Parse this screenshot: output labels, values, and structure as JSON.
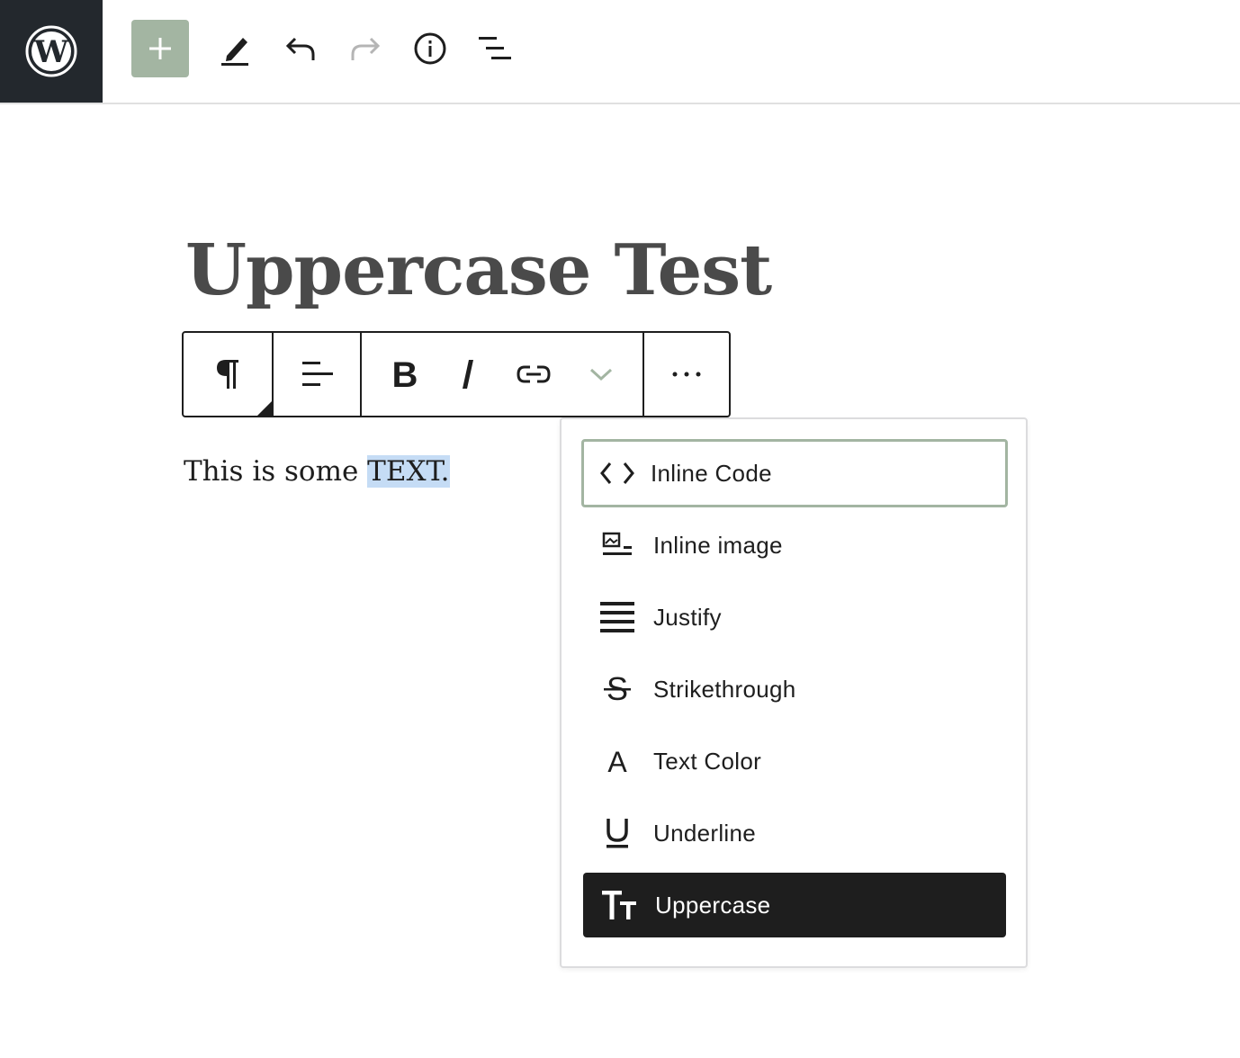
{
  "topbar": {
    "logo_icon": "wordpress-logo",
    "tools": [
      "add-block-icon",
      "edit-pencil-icon",
      "undo-icon",
      "redo-icon",
      "info-icon",
      "list-view-icon"
    ],
    "accent_color": "#a3b5a2"
  },
  "editor": {
    "post_title": "Uppercase Test",
    "paragraph_plain": "This is some ",
    "paragraph_selected": "TEXT."
  },
  "block_toolbar": {
    "buttons": [
      "paragraph-icon",
      "align-left-icon",
      "bold-icon",
      "italic-icon",
      "link-icon",
      "chevron-down-icon",
      "more-options-icon"
    ]
  },
  "format_menu": {
    "items": [
      {
        "label": "Inline Code",
        "icon": "code-brackets-icon",
        "state": "focused"
      },
      {
        "label": "Inline image",
        "icon": "inline-image-icon",
        "state": "normal"
      },
      {
        "label": "Justify",
        "icon": "justify-icon",
        "state": "normal"
      },
      {
        "label": "Strikethrough",
        "icon": "strikethrough-icon",
        "state": "normal"
      },
      {
        "label": "Text Color",
        "icon": "text-color-icon",
        "state": "normal"
      },
      {
        "label": "Underline",
        "icon": "underline-icon",
        "state": "normal"
      },
      {
        "label": "Uppercase",
        "icon": "uppercase-icon",
        "state": "active"
      }
    ],
    "active_bg": "#1e1e1e",
    "focus_border": "#a3b5a2"
  }
}
